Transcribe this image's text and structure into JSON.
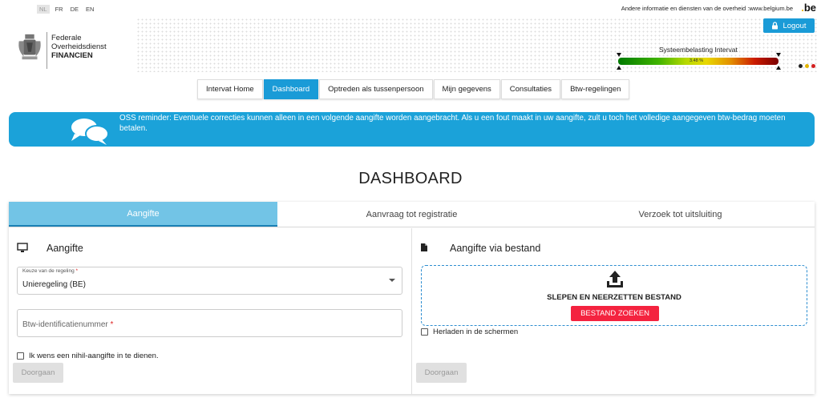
{
  "languages": [
    {
      "code": "NL",
      "active": true
    },
    {
      "code": "FR",
      "active": false
    },
    {
      "code": "DE",
      "active": false
    },
    {
      "code": "EN",
      "active": false
    }
  ],
  "top_info": {
    "text": "Andere informatie en diensten van de overheid :www.belgium.be",
    "be_logo": "be"
  },
  "logo": {
    "line1": "Federale",
    "line2": "Overheidsdienst",
    "line3": "FINANCIEN"
  },
  "logout_label": "Logout",
  "system_load": {
    "label": "Systeembelasting Intervat",
    "percent_text": "3.48 %",
    "value_percent": 3.48
  },
  "status_lights": [
    "#222222",
    "#e3b500",
    "#d42020"
  ],
  "nav": [
    {
      "label": "Intervat Home",
      "active": false
    },
    {
      "label": "Dashboard",
      "active": true
    },
    {
      "label": "Optreden als tussenpersoon",
      "active": false
    },
    {
      "label": "Mijn gegevens",
      "active": false
    },
    {
      "label": "Consultaties",
      "active": false
    },
    {
      "label": "Btw-regelingen",
      "active": false
    }
  ],
  "reminder": {
    "text": "OSS reminder: Eventuele correcties kunnen alleen in een volgende aangifte worden aangebracht. Als u een fout maakt in uw aangifte, zult u toch het volledige aangegeven btw-bedrag moeten betalen."
  },
  "page_title": "DASHBOARD",
  "tabs": [
    {
      "label": "Aangifte",
      "active": true
    },
    {
      "label": "Aanvraag tot registratie",
      "active": false
    },
    {
      "label": "Verzoek tot uitsluiting",
      "active": false
    }
  ],
  "left": {
    "title": "Aangifte",
    "select_label": "Keuze van de regeling",
    "select_value": "Unieregeling (BE)",
    "vat_placeholder": "Btw-identificatienummer",
    "required_mark": "*",
    "nil_checkbox_label": "Ik wens een nihil-aangifte in te dienen.",
    "continue_label": "Doorgaan"
  },
  "right": {
    "title": "Aangifte via bestand",
    "dropzone_text": "SLEPEN EN NEERZETTEN BESTAND",
    "browse_label": "BESTAND ZOEKEN",
    "reload_checkbox_label": "Herladen in de schermen",
    "continue_label": "Doorgaan"
  },
  "colors": {
    "primary_blue": "#1a9bd7",
    "active_tab": "#72c4e6",
    "browse_button": "#f4233f"
  }
}
